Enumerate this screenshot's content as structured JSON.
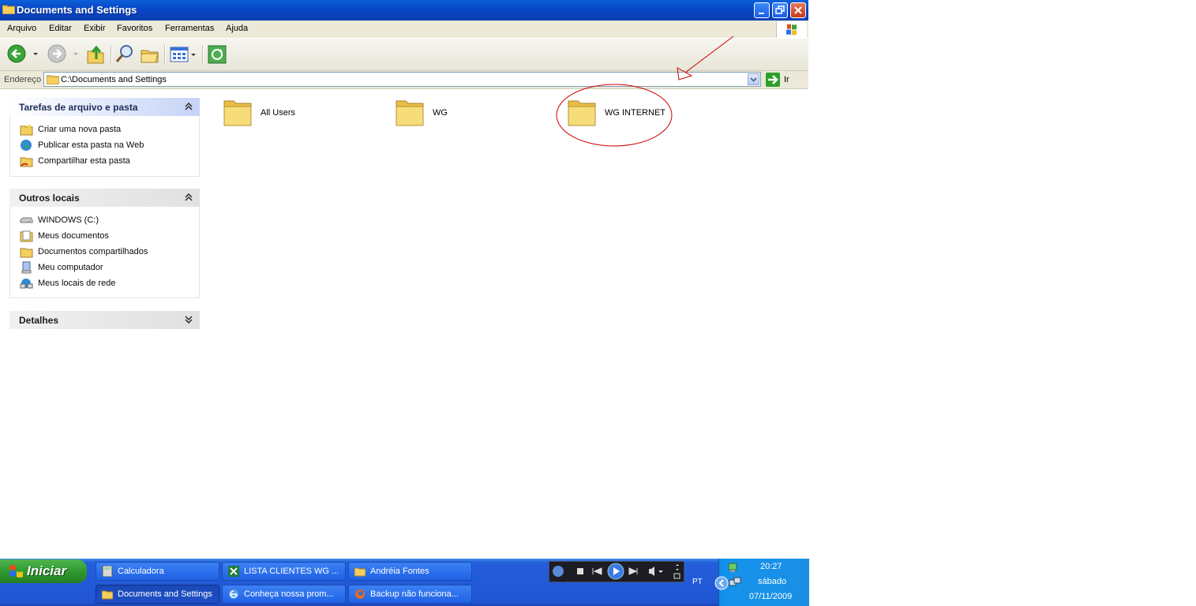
{
  "window": {
    "title": "Documents and Settings"
  },
  "menu": {
    "items": [
      "Arquivo",
      "Editar",
      "Exibir",
      "Favoritos",
      "Ferramentas",
      "Ajuda"
    ]
  },
  "address": {
    "label": "Endereço",
    "path": "C:\\Documents and Settings",
    "go_label": "Ir"
  },
  "tasks_panel": {
    "title": "Tarefas de arquivo e pasta",
    "links": [
      "Criar uma nova pasta",
      "Publicar esta pasta na Web",
      "Compartilhar esta pasta"
    ]
  },
  "other_panel": {
    "title": "Outros locais",
    "links": [
      "WINDOWS (C:)",
      "Meus documentos",
      "Documentos compartilhados",
      "Meu computador",
      "Meus locais de rede"
    ]
  },
  "details_panel": {
    "title": "Detalhes"
  },
  "folders": [
    "All Users",
    "WG",
    "WG INTERNET"
  ],
  "taskbar": {
    "start_label": "Iniciar",
    "tasks_row1": [
      "Calculadora",
      "LISTA CLIENTES WG ...",
      "Andréia Fontes"
    ],
    "tasks_row2": [
      "Documents and Settings",
      "Conheça nossa prom...",
      "Backup não funciona..."
    ],
    "language": "PT",
    "clock": {
      "time": "20:27",
      "day": "sábado",
      "date": "07/11/2009"
    }
  },
  "colors": {
    "titlebar": "#0a4fd0",
    "taskbar": "#245edb",
    "start_button": "#2f9a2f",
    "annotation": "#cc0000"
  }
}
